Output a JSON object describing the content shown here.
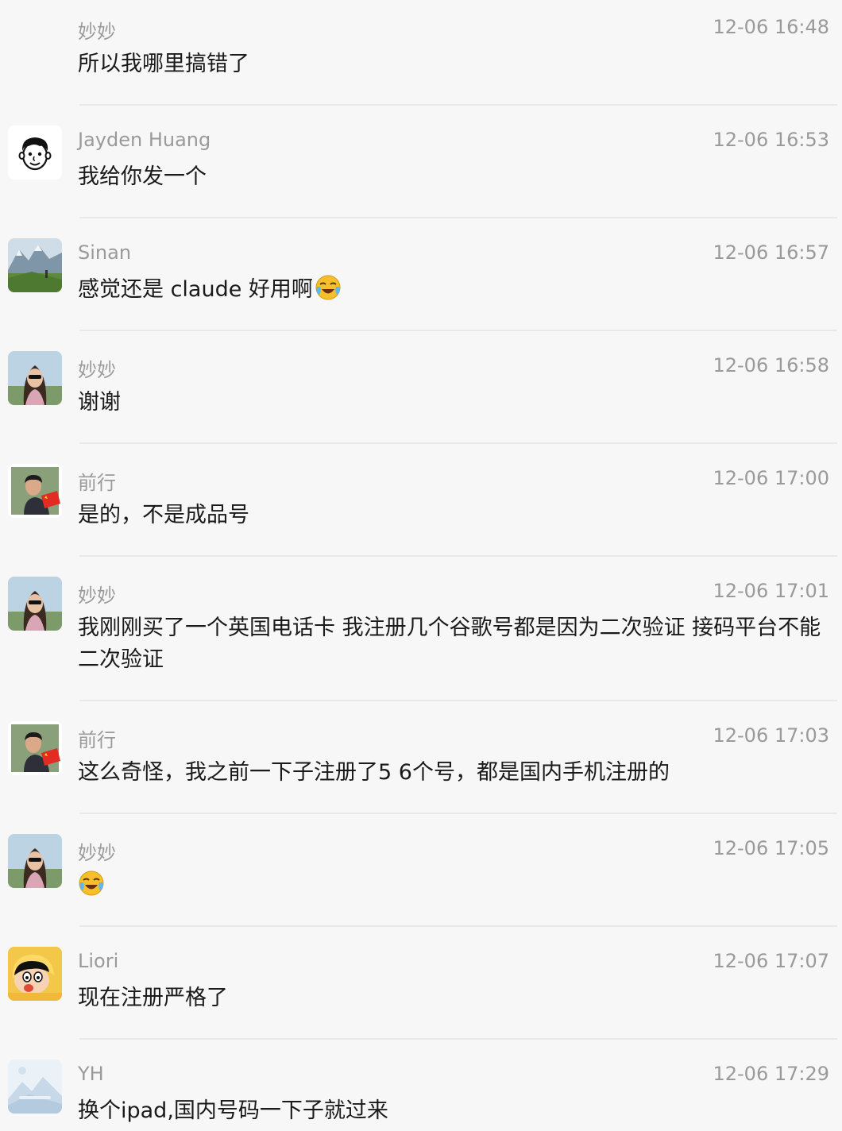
{
  "messages": [
    {
      "sender": "妙妙",
      "time": "12-06 16:48",
      "text": "所以我哪里搞错了",
      "avatar": "none"
    },
    {
      "sender": "Jayden Huang",
      "time": "12-06 16:53",
      "text": "我给你发一个",
      "avatar": "cartoon-face-icon"
    },
    {
      "sender": "Sinan",
      "time": "12-06 16:57",
      "text": "感觉还是 claude 好用啊",
      "emoji": "laughing-crying-face-icon",
      "avatar": "mountain-photo"
    },
    {
      "sender": "妙妙",
      "time": "12-06 16:58",
      "text": "谢谢",
      "avatar": "woman-photo"
    },
    {
      "sender": "前行",
      "time": "12-06 17:00",
      "text": "是的，不是成品号",
      "avatar": "man-flag-photo"
    },
    {
      "sender": "妙妙",
      "time": "12-06 17:01",
      "text": "我刚刚买了一个英国电话卡 我注册几个谷歌号都是因为二次验证 接码平台不能二次验证",
      "avatar": "woman-photo"
    },
    {
      "sender": "前行",
      "time": "12-06 17:03",
      "text": "这么奇怪，我之前一下子注册了5  6个号，都是国内手机注册的",
      "avatar": "man-flag-photo"
    },
    {
      "sender": "妙妙",
      "time": "12-06 17:05",
      "text": "",
      "emoji": "laughing-crying-face-icon",
      "avatar": "woman-photo"
    },
    {
      "sender": "Liori",
      "time": "12-06 17:07",
      "text": "现在注册严格了",
      "avatar": "cartoon-boy-yellow"
    },
    {
      "sender": "YH",
      "time": "12-06 17:29",
      "text": "换个ipad,国内号码一下子就过来",
      "avatar": "landscape-placeholder-icon"
    }
  ],
  "colors": {
    "background": "#f7f7f7",
    "divider": "#e9e9e9",
    "meta_text": "#9a9a9a",
    "body_text": "#1a1a1a"
  }
}
